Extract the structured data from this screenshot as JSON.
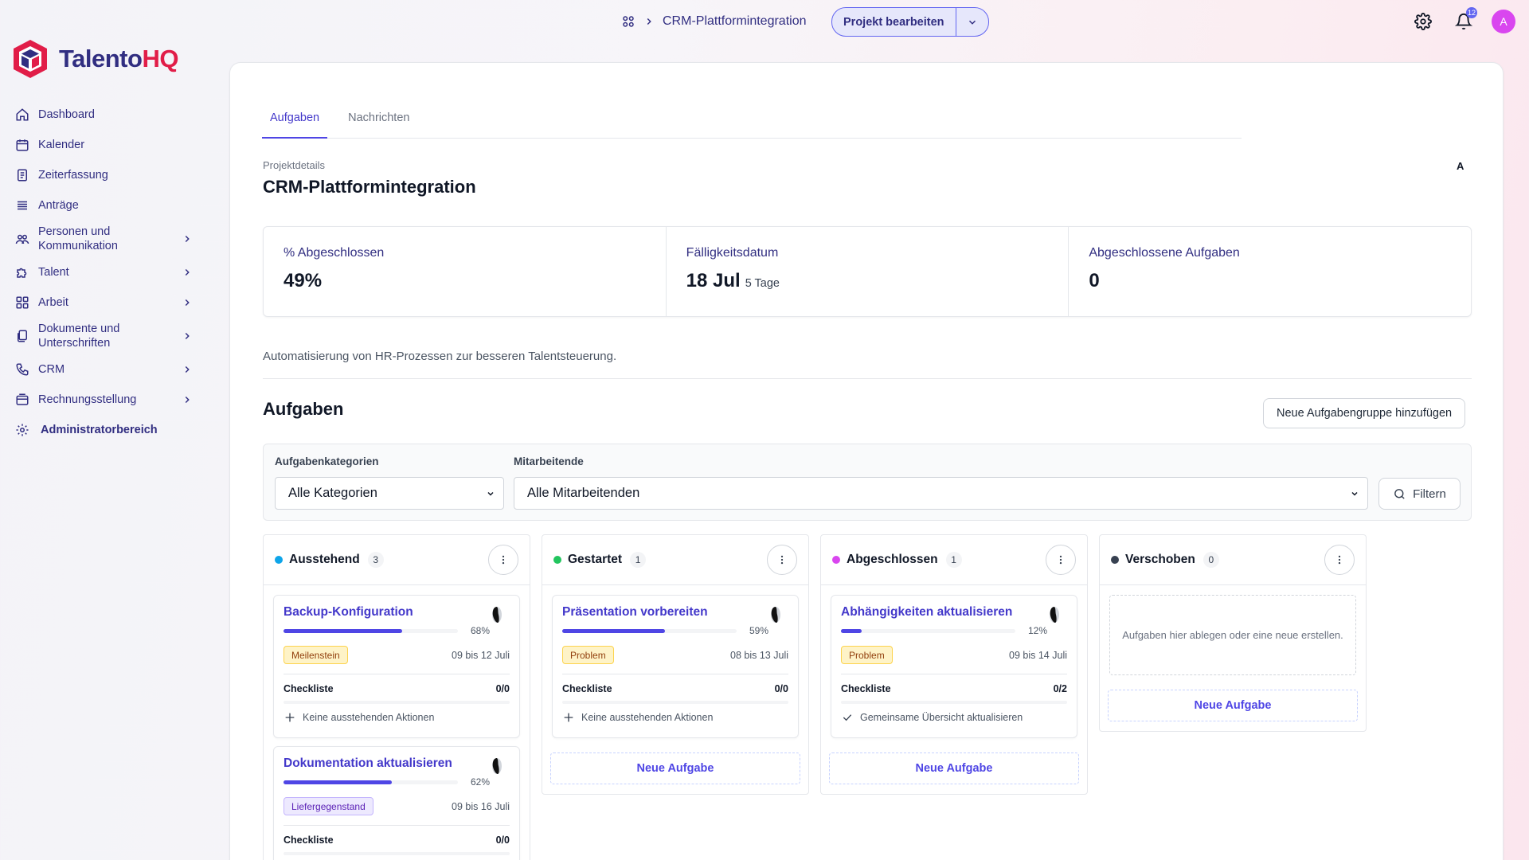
{
  "brand": {
    "part1": "Talento",
    "part2": "HQ"
  },
  "colors": {
    "primary": "#4f46e5",
    "navy": "#312e81",
    "brand_red": "#e11d48",
    "avatar": "#d946ef"
  },
  "nav": {
    "dashboard": "Dashboard",
    "kalender": "Kalender",
    "zeit": "Zeiterfassung",
    "antraege": "Anträge",
    "personen": "Personen und Kommunikation",
    "talent": "Talent",
    "arbeit": "Arbeit",
    "dokumente": "Dokumente und Unterschriften",
    "crm": "CRM",
    "rechnung": "Rechnungsstellung",
    "admin": "Administratorbereich"
  },
  "topbar": {
    "breadcrumb_title": "CRM-Plattformintegration",
    "edit_label": "Projekt bearbeiten",
    "notification_count": "12",
    "avatar_initial": "A"
  },
  "tabs": {
    "tasks": "Aufgaben",
    "messages": "Nachrichten"
  },
  "project": {
    "details_label": "Projektdetails",
    "title": "CRM-Plattformintegration",
    "member_initial": "A",
    "description": "Automatisierung von HR-Prozessen zur besseren Talentsteuerung."
  },
  "stats": {
    "completed_label": "% Abgeschlossen",
    "completed_value": "49%",
    "due_label": "Fälligkeitsdatum",
    "due_value": "18 Jul",
    "due_sub": "5 Tage",
    "done_tasks_label": "Abgeschlossene Aufgaben",
    "done_tasks_value": "0"
  },
  "tasks_section": {
    "heading": "Aufgaben",
    "add_group": "Neue Aufgabengruppe hinzufügen",
    "category_label": "Aufgabenkategorien",
    "category_value": "Alle Kategorien",
    "staff_label": "Mitarbeitende",
    "staff_value": "Alle Mitarbeitenden",
    "filter": "Filtern"
  },
  "columns": {
    "pending": {
      "title": "Ausstehend",
      "count": "3",
      "color": "#0ea5e9",
      "cards": [
        {
          "title": "Backup-Konfiguration",
          "progress": 0.68,
          "pct": "68%",
          "tag": "Meilenstein",
          "dates": "09 bis 12 Juli",
          "checklist": "Checkliste",
          "checklist_value": "0/0",
          "action": "Keine ausstehenden Aktionen"
        },
        {
          "title": "Dokumentation aktualisieren",
          "progress": 0.62,
          "pct": "62%",
          "tag": "Liefergegenstand",
          "dates": "09 bis 16 Juli",
          "checklist": "Checkliste",
          "checklist_value": "0/0"
        }
      ]
    },
    "started": {
      "title": "Gestartet",
      "count": "1",
      "color": "#22c55e",
      "cards": [
        {
          "title": "Präsentation vorbereiten",
          "progress": 0.59,
          "pct": "59%",
          "tag": "Problem",
          "dates": "08 bis 13 Juli",
          "checklist": "Checkliste",
          "checklist_value": "0/0",
          "action": "Keine ausstehenden Aktionen"
        }
      ],
      "new_task": "Neue Aufgabe"
    },
    "completed": {
      "title": "Abgeschlossen",
      "count": "1",
      "color": "#d946ef",
      "cards": [
        {
          "title": "Abhängigkeiten aktualisieren",
          "progress": 0.12,
          "pct": "12%",
          "tag": "Problem",
          "dates": "09 bis 14 Juli",
          "checklist": "Checkliste",
          "checklist_value": "0/2",
          "action": "Gemeinsame Übersicht aktualisieren"
        }
      ],
      "new_task": "Neue Aufgabe"
    },
    "postponed": {
      "title": "Verschoben",
      "count": "0",
      "color": "#374151",
      "drop_text": "Aufgaben hier ablegen oder eine neue erstellen.",
      "new_task": "Neue Aufgabe"
    }
  }
}
